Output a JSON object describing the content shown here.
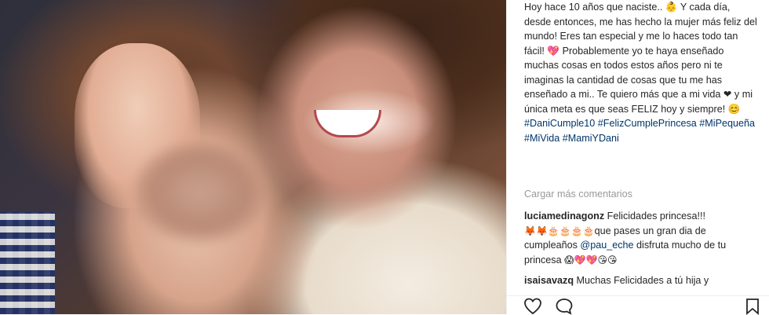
{
  "post": {
    "caption_text": "Hoy hace 10 años que naciste.. 👶 Y cada día, desde entonces, me has hecho la mujer más feliz del mundo! Eres tan especial y me lo haces todo tan fácil! 💖 Probablemente yo te haya enseñado muchas cosas en todos estos años pero ni te imaginas la cantidad de cosas que tu me has enseñado a mi.. Te quiero más que a mi vida ❤ y mi única meta es que seas FELIZ hoy y siempre! 😊",
    "hashtags": "#DaniCumple10 #FelizCumplePrincesa #MiPequeña #MiVida #MamiYDani"
  },
  "load_more": "Cargar más comentarios",
  "comments": [
    {
      "user": "luciamedinagonz",
      "text_a": " Felicidades princesa!!! ",
      "emojis_a": "🦊🦊🎂🎂🎂🎂",
      "text_b": "que pases un gran dia de cumpleaños ",
      "mention": "@pau_eche",
      "text_c": " disfruta mucho de tu princesa ",
      "emojis_b": "😱💖💖😘😘"
    },
    {
      "user": "isaisavazq",
      "text": " Muchas Felicidades a tú hija y"
    }
  ],
  "icons": {
    "like": "heart-outline-icon",
    "comment": "speech-bubble-icon",
    "save": "bookmark-icon"
  }
}
